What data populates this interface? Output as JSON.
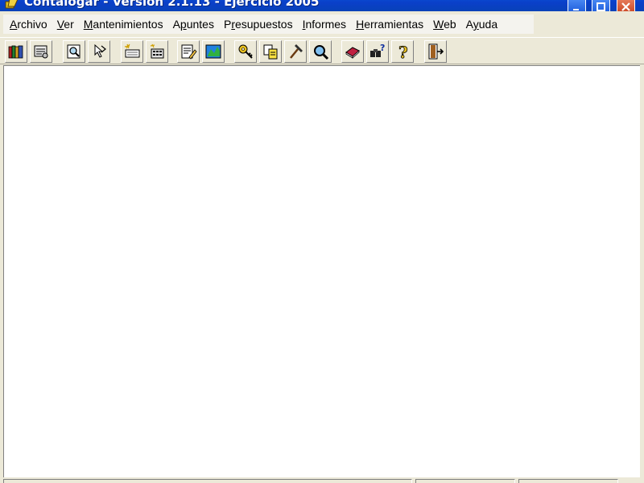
{
  "window": {
    "title": "Contalogar - Versión 2.1.13 - Ejercicio 2005",
    "controls": [
      "minimize-icon",
      "maximize-icon",
      "close-icon"
    ]
  },
  "menubar": {
    "items": [
      {
        "label": "Archivo",
        "mnemonic": "A"
      },
      {
        "label": "Ver",
        "mnemonic": "V"
      },
      {
        "label": "Mantenimientos",
        "mnemonic": "M"
      },
      {
        "label": "Apuntes",
        "mnemonic": "p"
      },
      {
        "label": "Presupuestos",
        "mnemonic": "r"
      },
      {
        "label": "Informes",
        "mnemonic": "I"
      },
      {
        "label": "Herramientas",
        "mnemonic": "H"
      },
      {
        "label": "Web",
        "mnemonic": "W"
      },
      {
        "label": "Ayuda",
        "mnemonic": "y"
      }
    ]
  },
  "toolbar": {
    "buttons": [
      {
        "icon": "books-icon"
      },
      {
        "icon": "ledger-icon"
      },
      {
        "icon": "document-search-icon"
      },
      {
        "icon": "cursor-transfer-icon"
      },
      {
        "icon": "new-entry-icon"
      },
      {
        "icon": "calculator-entry-icon"
      },
      {
        "icon": "edit-report-icon"
      },
      {
        "icon": "chart-map-icon"
      },
      {
        "icon": "key-icon"
      },
      {
        "icon": "copy-icon"
      },
      {
        "icon": "hammer-icon"
      },
      {
        "icon": "magnifier-icon"
      },
      {
        "icon": "book-icon"
      },
      {
        "icon": "help-search-icon"
      },
      {
        "icon": "question-icon"
      },
      {
        "icon": "exit-door-icon"
      }
    ]
  },
  "colors": {
    "titlebar": "#0a3fc9",
    "chrome": "#ece9d8",
    "client": "#ffffff"
  }
}
